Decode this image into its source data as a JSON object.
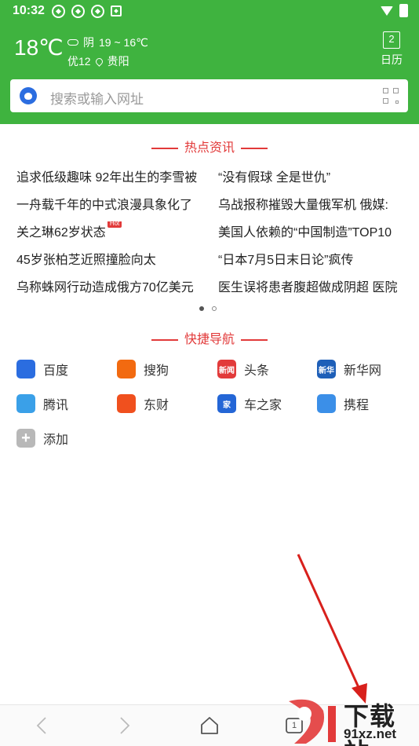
{
  "status_bar": {
    "time": "10:32"
  },
  "weather": {
    "temp": "18℃",
    "condition": "阴",
    "range": "19 ~ 16℃",
    "aqi": "优12",
    "city": "贵阳"
  },
  "calendar": {
    "day": "2",
    "label": "日历"
  },
  "search": {
    "placeholder": "搜索或输入网址"
  },
  "hot_news": {
    "title": "热点资讯",
    "hot_label": "Hot",
    "left": [
      "追求低级趣味 92年出生的李雪被",
      "一舟载千年的中式浪漫具象化了",
      "关之琳62岁状态",
      "45岁张柏芝近照撞脸向太",
      "乌称蛛网行动造成俄方70亿美元"
    ],
    "right": [
      "“没有假球 全是世仇”",
      "乌战报称摧毁大量俄军机 俄媒:",
      "美国人依赖的“中国制造”TOP10",
      "“日本7月5日末日论”疯传",
      "医生误将患者腹超做成阴超 医院"
    ]
  },
  "quick_nav": {
    "title": "快捷导航",
    "items": [
      {
        "label": "百度",
        "icon": "baidu-icon",
        "color": "#2b6de0"
      },
      {
        "label": "搜狗",
        "icon": "sogou-icon",
        "color": "#f26a10"
      },
      {
        "label": "头条",
        "icon": "toutiao-icon",
        "color": "#e23a3a",
        "icon_text": "新闻"
      },
      {
        "label": "新华网",
        "icon": "xinhua-icon",
        "color": "#1e5fb8",
        "icon_text": "新华"
      },
      {
        "label": "腾讯",
        "icon": "tencent-icon",
        "color": "#3aa0e8"
      },
      {
        "label": "东财",
        "icon": "dongcai-icon",
        "color": "#f0501e"
      },
      {
        "label": "车之家",
        "icon": "autohome-icon",
        "color": "#2466d6",
        "icon_text": "家"
      },
      {
        "label": "携程",
        "icon": "ctrip-icon",
        "color": "#3b8fe8"
      },
      {
        "label": "添加",
        "icon": "add-icon",
        "color": "#b8b8b8",
        "icon_text": "+"
      }
    ]
  },
  "bottom_bar": {
    "tab_count": "1"
  },
  "watermark": {
    "main": "下载站",
    "url": "91xz.net"
  }
}
